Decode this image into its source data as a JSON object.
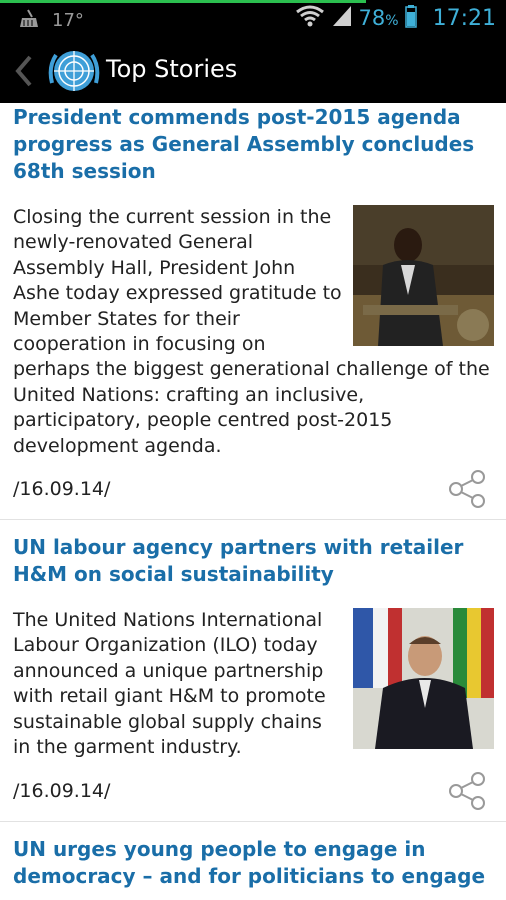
{
  "status_bar": {
    "temperature": "17°",
    "battery": "78",
    "battery_unit": "%",
    "time": "17:21"
  },
  "app_bar": {
    "title": "Top Stories"
  },
  "stories": [
    {
      "headline": "President commends post-2015 agenda progress as General Assembly concludes 68th session",
      "summary": "Closing the current session in the newly-renovated General Assembly Hall, President John Ashe today expressed gratitude to Member States for their cooperation in focusing on perhaps the biggest generational challenge of the United Nations: crafting an inclusive, participatory, people centred post-2015 development agenda.",
      "date": "/16.09.14/"
    },
    {
      "headline": "UN labour agency partners with retailer H&M on social sustainability",
      "summary": "The United Nations International Labour Organization (ILO) today announced a unique partnership with retail giant H&M to promote sustainable global supply chains in the garment industry.",
      "date": "/16.09.14/"
    },
    {
      "headline": "UN urges young people to engage in democracy – and for politicians to engage"
    }
  ],
  "colors": {
    "headline": "#1a6ea8",
    "status_accent": "#3fb0d8",
    "progress_line": "#2bbf4f"
  }
}
